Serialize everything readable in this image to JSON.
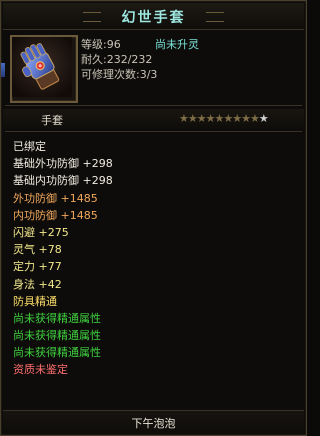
{
  "title": "幻世手套",
  "icon": "gauntlet-icon",
  "stats_top": {
    "level": "等级:96",
    "status": "尚未升灵",
    "durability": "耐久:232/232",
    "repairs": "可修理次数:3/3"
  },
  "item_type": "手套",
  "stars": {
    "total": 10,
    "filled": 9,
    "symbol": "★"
  },
  "attributes": [
    {
      "text": "已绑定",
      "color": "#f1ede2"
    },
    {
      "text": "基础外功防御 +298",
      "color": "#f1ede2"
    },
    {
      "text": "基础内功防御 +298",
      "color": "#f1ede2"
    },
    {
      "text": "外功防御 +1485",
      "color": "#f2a85c"
    },
    {
      "text": "内功防御 +1485",
      "color": "#f2a85c"
    },
    {
      "text": "闪避 +275",
      "color": "#f2e88c"
    },
    {
      "text": "灵气 +78",
      "color": "#f2e88c"
    },
    {
      "text": "定力 +77",
      "color": "#f2e88c"
    },
    {
      "text": "身法 +42",
      "color": "#f2e88c"
    },
    {
      "text": "防具精通",
      "color": "#ffdf6a"
    },
    {
      "text": "尚未获得精通属性",
      "color": "#3fd13f"
    },
    {
      "text": "尚未获得精通属性",
      "color": "#3fd13f"
    },
    {
      "text": "尚未获得精通属性",
      "color": "#3fd13f"
    },
    {
      "text": "资质未鉴定",
      "color": "#ff6e6e"
    }
  ],
  "footer": "下午泡泡",
  "colors": {
    "title": "#9ee6e0",
    "status": "#7ce3d8",
    "border": "#4a3f2c"
  }
}
